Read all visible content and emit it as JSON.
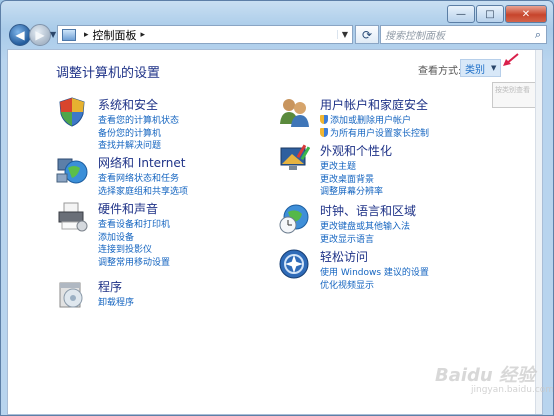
{
  "address": {
    "path": "控制面板",
    "search_placeholder": "搜索控制面板"
  },
  "window_buttons": {
    "minimize": "—",
    "maximize": "□",
    "close": "✕"
  },
  "main": {
    "title": "调整计算机的设置",
    "view_by_label": "查看方式:",
    "view_by_value": "类别",
    "tooltip": "按类别查看"
  },
  "categories": {
    "system": {
      "title": "系统和安全",
      "links": [
        "查看您的计算机状态",
        "备份您的计算机",
        "查找并解决问题"
      ]
    },
    "network": {
      "title": "网络和 Internet",
      "links": [
        "查看网络状态和任务",
        "选择家庭组和共享选项"
      ]
    },
    "hardware": {
      "title": "硬件和声音",
      "links": [
        "查看设备和打印机",
        "添加设备",
        "连接到投影仪",
        "调整常用移动设置"
      ]
    },
    "programs": {
      "title": "程序",
      "links": [
        "卸载程序"
      ]
    },
    "users": {
      "title": "用户帐户和家庭安全",
      "links": [
        "添加或删除用户帐户",
        "为所有用户设置家长控制"
      ]
    },
    "appearance": {
      "title": "外观和个性化",
      "links": [
        "更改主题",
        "更改桌面背景",
        "调整屏幕分辨率"
      ]
    },
    "clock": {
      "title": "时钟、语言和区域",
      "links": [
        "更改键盘或其他输入法",
        "更改显示语言"
      ]
    },
    "ease": {
      "title": "轻松访问",
      "links": [
        "使用 Windows 建议的设置",
        "优化视频显示"
      ]
    }
  },
  "watermark": {
    "text": "Baidu 经验",
    "sub": "jingyan.baidu.com"
  }
}
